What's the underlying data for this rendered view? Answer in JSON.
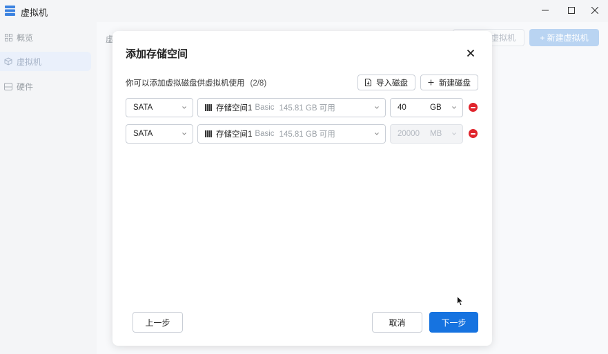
{
  "window": {
    "title": "虚拟机",
    "minimize": "—",
    "maximize": "☐",
    "close": "✕"
  },
  "sidebar": {
    "items": [
      {
        "label": "概览",
        "icon": "grid-icon"
      },
      {
        "label": "虚拟机",
        "icon": "cube-icon",
        "active": true
      },
      {
        "label": "硬件",
        "icon": "drive-icon"
      }
    ]
  },
  "background": {
    "fragment": "虚",
    "outline_button": "虚拟机",
    "primary_button": "+  新建虚拟机"
  },
  "dialog": {
    "title": "添加存储空间",
    "hint": "你可以添加虚拟磁盘供虚拟机使用",
    "count": "(2/8)",
    "import_button": "导入磁盘",
    "new_button": "新建磁盘",
    "disks": [
      {
        "bus": "SATA",
        "pool_name": "存储空间1",
        "pool_type": "Basic",
        "pool_free": "145.81 GB 可用",
        "size": "40",
        "unit": "GB",
        "disabled": false
      },
      {
        "bus": "SATA",
        "pool_name": "存储空间1",
        "pool_type": "Basic",
        "pool_free": "145.81 GB 可用",
        "size": "20000",
        "unit": "MB",
        "disabled": true
      }
    ],
    "prev_button": "上一步",
    "cancel_button": "取消",
    "next_button": "下一步"
  },
  "colors": {
    "primary": "#1673e0",
    "danger": "#e0242c",
    "sidebar_active": "#eaf0fb"
  }
}
